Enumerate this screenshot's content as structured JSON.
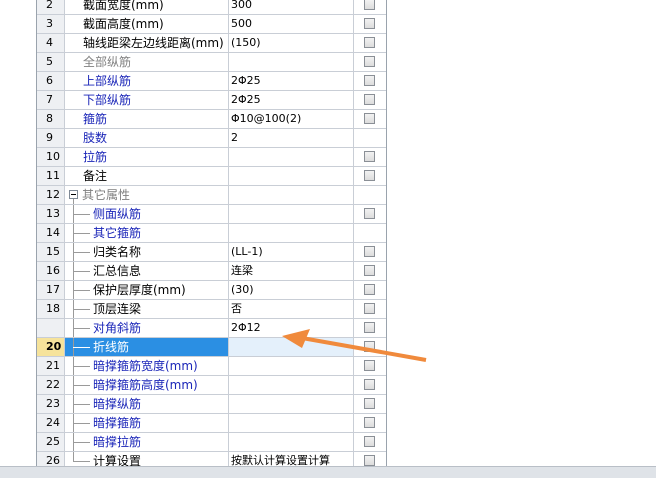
{
  "rows": [
    {
      "num": "2",
      "name": "截面宽度(mm)",
      "value": "300",
      "checkbox": true,
      "color": "black",
      "indent": 0
    },
    {
      "num": "3",
      "name": "截面高度(mm)",
      "value": "500",
      "checkbox": true,
      "color": "black",
      "indent": 0
    },
    {
      "num": "4",
      "name": "轴线距梁左边线距离(mm)",
      "value": "(150)",
      "checkbox": true,
      "color": "black",
      "indent": 0
    },
    {
      "num": "5",
      "name": "全部纵筋",
      "value": "",
      "checkbox": true,
      "color": "gray",
      "indent": 0
    },
    {
      "num": "6",
      "name": "上部纵筋",
      "value": "2Φ25",
      "checkbox": true,
      "color": "blue",
      "indent": 0
    },
    {
      "num": "7",
      "name": "下部纵筋",
      "value": "2Φ25",
      "checkbox": true,
      "color": "blue",
      "indent": 0
    },
    {
      "num": "8",
      "name": "箍筋",
      "value": "Φ10@100(2)",
      "checkbox": true,
      "color": "blue",
      "indent": 0
    },
    {
      "num": "9",
      "name": "肢数",
      "value": "2",
      "checkbox": false,
      "color": "blue",
      "indent": 0
    },
    {
      "num": "10",
      "name": "拉筋",
      "value": "",
      "checkbox": true,
      "color": "blue",
      "indent": 0
    },
    {
      "num": "11",
      "name": "备注",
      "value": "",
      "checkbox": true,
      "color": "black",
      "indent": 0
    },
    {
      "num": "12",
      "name": "其它属性",
      "value": "",
      "checkbox": false,
      "color": "gray",
      "indent": 0,
      "group": true
    },
    {
      "num": "13",
      "name": "侧面纵筋",
      "value": "",
      "checkbox": true,
      "color": "blue",
      "indent": 1
    },
    {
      "num": "14",
      "name": "其它箍筋",
      "value": "",
      "checkbox": false,
      "color": "blue",
      "indent": 1
    },
    {
      "num": "15",
      "name": "归类名称",
      "value": "(LL-1)",
      "checkbox": true,
      "color": "black",
      "indent": 1
    },
    {
      "num": "16",
      "name": "汇总信息",
      "value": "连梁",
      "checkbox": true,
      "color": "black",
      "indent": 1
    },
    {
      "num": "17",
      "name": "保护层厚度(mm)",
      "value": "(30)",
      "checkbox": true,
      "color": "black",
      "indent": 1
    },
    {
      "num": "18",
      "name": "顶层连梁",
      "value": "否",
      "checkbox": true,
      "color": "black",
      "indent": 1
    },
    {
      "num": "",
      "name": "对角斜筋",
      "value": "2Φ12",
      "checkbox": true,
      "color": "blue",
      "indent": 1
    },
    {
      "num": "20",
      "name": "折线筋",
      "value": "",
      "checkbox": true,
      "color": "blue",
      "indent": 1,
      "selected": true
    },
    {
      "num": "21",
      "name": "暗撑箍筋宽度(mm)",
      "value": "",
      "checkbox": true,
      "color": "blue",
      "indent": 1
    },
    {
      "num": "22",
      "name": "暗撑箍筋高度(mm)",
      "value": "",
      "checkbox": true,
      "color": "blue",
      "indent": 1
    },
    {
      "num": "23",
      "name": "暗撑纵筋",
      "value": "",
      "checkbox": true,
      "color": "blue",
      "indent": 1
    },
    {
      "num": "24",
      "name": "暗撑箍筋",
      "value": "",
      "checkbox": true,
      "color": "blue",
      "indent": 1
    },
    {
      "num": "25",
      "name": "暗撑拉筋",
      "value": "",
      "checkbox": true,
      "color": "blue",
      "indent": 1
    },
    {
      "num": "26",
      "name": "计算设置",
      "value": "按默认计算设置计算",
      "checkbox": true,
      "color": "black",
      "indent": 1
    }
  ],
  "annotation": {
    "color": "#f08a3c"
  }
}
